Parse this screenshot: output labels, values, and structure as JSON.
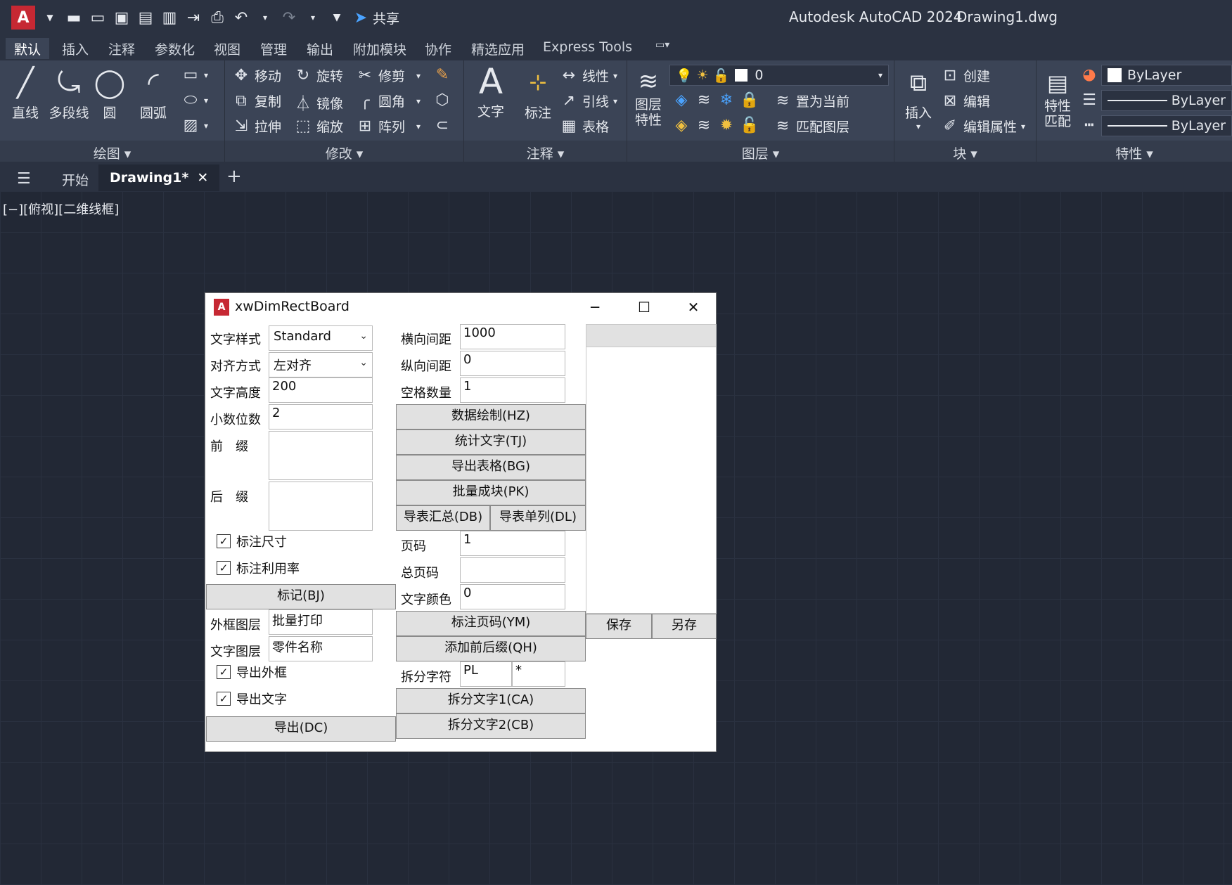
{
  "app": {
    "logo_letter": "A",
    "title": "Autodesk AutoCAD 2024",
    "file": "Drawing1.dwg",
    "share": "共享"
  },
  "menus": [
    "默认",
    "插入",
    "注释",
    "参数化",
    "视图",
    "管理",
    "输出",
    "附加模块",
    "协作",
    "精选应用",
    "Express Tools"
  ],
  "ribbon": {
    "draw": {
      "title": "绘图",
      "line": "直线",
      "polyline": "多段线",
      "circle": "圆",
      "arc": "圆弧"
    },
    "modify": {
      "title": "修改",
      "move": "移动",
      "rotate": "旋转",
      "trim": "修剪",
      "copy": "复制",
      "mirror": "镜像",
      "fillet": "圆角",
      "stretch": "拉伸",
      "scale": "缩放",
      "array": "阵列"
    },
    "annotation": {
      "title": "注释",
      "text": "文字",
      "dim": "标注",
      "linear": "线性",
      "leader": "引线",
      "table": "表格"
    },
    "layers": {
      "title": "图层",
      "props": "图层特性",
      "current_layer": "0",
      "make_current": "置为当前",
      "match_layer": "匹配图层"
    },
    "block": {
      "title": "块",
      "insert": "插入",
      "create": "创建",
      "edit": "编辑",
      "edit_attr": "编辑属性"
    },
    "properties": {
      "title": "特性",
      "match": "特性匹配",
      "color": "ByLayer",
      "linetype": "ByLayer",
      "lineweight": "ByLayer"
    }
  },
  "tabs": {
    "start": "开始",
    "drawing": "Drawing1*"
  },
  "view_label": "[−][俯视][二维线框]",
  "dialog": {
    "title": "xwDimRectBoard",
    "text_style_label": "文字样式",
    "text_style": "Standard",
    "align_label": "对齐方式",
    "align": "左对齐",
    "text_height_label": "文字高度",
    "text_height": "200",
    "decimals_label": "小数位数",
    "decimals": "2",
    "prefix_label": "前　缀",
    "suffix_label": "后　缀",
    "chk_dim": "标注尺寸",
    "chk_ratio": "标注利用率",
    "mark_btn": "标记(BJ)",
    "frame_layer_label": "外框图层",
    "frame_layer": "批量打印",
    "text_layer_label": "文字图层",
    "text_layer": "零件名称",
    "chk_export_frame": "导出外框",
    "chk_export_text": "导出文字",
    "export_btn": "导出(DC)",
    "h_spacing_label": "横向间距",
    "h_spacing": "1000",
    "v_spacing_label": "纵向间距",
    "v_spacing": "0",
    "spaces_label": "空格数量",
    "spaces": "1",
    "btn_hz": "数据绘制(HZ)",
    "btn_tj": "统计文字(TJ)",
    "btn_bg": "导出表格(BG)",
    "btn_pk": "批量成块(PK)",
    "btn_db": "导表汇总(DB)",
    "btn_dl": "导表单列(DL)",
    "page_label": "页码",
    "page": "1",
    "total_pages_label": "总页码",
    "total_pages": "",
    "text_color_label": "文字颜色",
    "text_color": "0",
    "btn_ym": "标注页码(YM)",
    "btn_qh": "添加前后缀(QH)",
    "split_char_label": "拆分字符",
    "split_char1": "PL",
    "split_char2": "*",
    "btn_ca": "拆分文字1(CA)",
    "btn_cb": "拆分文字2(CB)",
    "save_btn": "保存",
    "save_as_btn": "另存"
  }
}
